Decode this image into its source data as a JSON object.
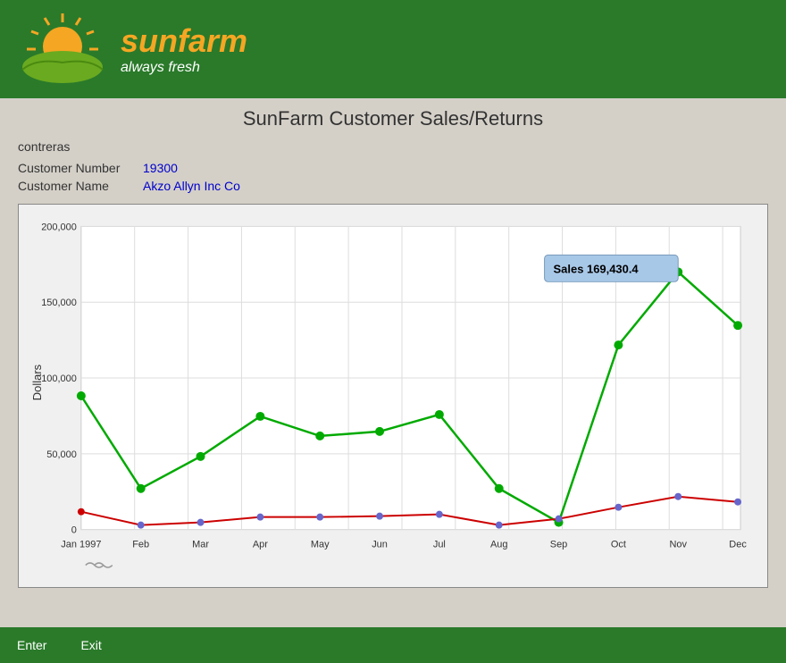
{
  "header": {
    "brand_name": "sunfarm",
    "brand_tagline": "always fresh"
  },
  "page": {
    "title": "SunFarm Customer Sales/Returns",
    "user": "contreras"
  },
  "customer": {
    "number_label": "Customer Number",
    "number_value": "19300",
    "name_label": "Customer Name",
    "name_value": "Akzo Allyn Inc Co"
  },
  "chart": {
    "y_axis_label": "Dollars",
    "y_axis_ticks": [
      "200,000",
      "150,000",
      "100,000",
      "50,000",
      "0"
    ],
    "x_axis_labels": [
      "Jan 1997",
      "Feb",
      "Mar",
      "Apr",
      "May",
      "Jun",
      "Jul",
      "Aug",
      "Sep",
      "Oct",
      "Nov",
      "Dec"
    ],
    "tooltip": "Sales 169,430.4",
    "sales_data": [
      88000,
      27000,
      48000,
      75000,
      62000,
      65000,
      76000,
      27000,
      5000,
      122000,
      170000,
      135000
    ],
    "returns_data": [
      12000,
      3000,
      5000,
      8000,
      8000,
      9000,
      10000,
      3000,
      7000,
      15000,
      22000,
      18000
    ]
  },
  "footer": {
    "enter_label": "Enter",
    "exit_label": "Exit"
  }
}
